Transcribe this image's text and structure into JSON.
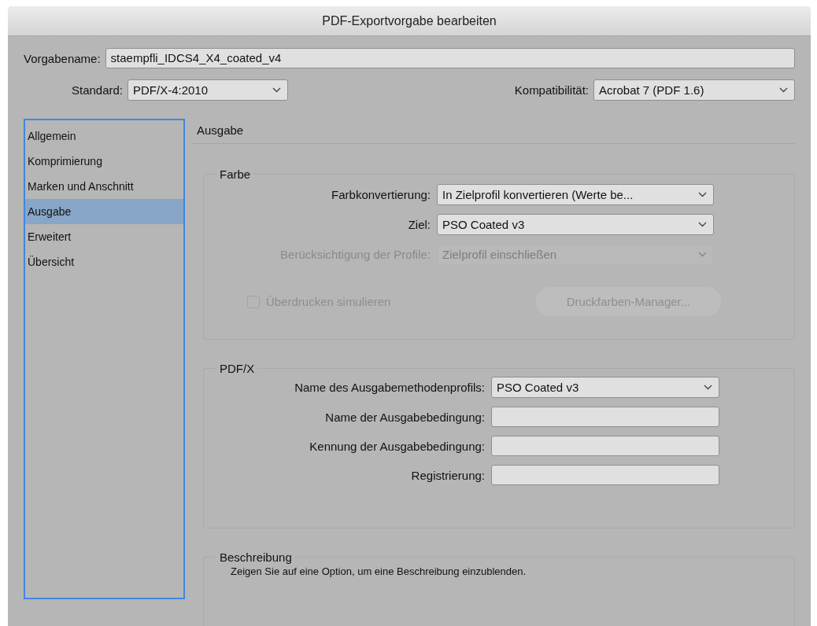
{
  "window": {
    "title": "PDF-Exportvorgabe bearbeiten"
  },
  "preset": {
    "label": "Vorgabename:",
    "value": "staempfli_IDCS4_X4_coated_v4"
  },
  "standard": {
    "label": "Standard:",
    "value": "PDF/X-4:2010"
  },
  "compatibility": {
    "label": "Kompatibilität:",
    "value": "Acrobat 7 (PDF 1.6)"
  },
  "sidebar": {
    "items": [
      {
        "label": "Allgemein",
        "selected": false
      },
      {
        "label": "Komprimierung",
        "selected": false
      },
      {
        "label": "Marken und Anschnitt",
        "selected": false
      },
      {
        "label": "Ausgabe",
        "selected": true
      },
      {
        "label": "Erweitert",
        "selected": false
      },
      {
        "label": "Übersicht",
        "selected": false
      }
    ]
  },
  "panel": {
    "title": "Ausgabe",
    "color_group": {
      "title": "Farbe",
      "rows": [
        {
          "kind": "select",
          "label": "Farbkonvertierung:",
          "value": "In Zielprofil konvertieren (Werte be...",
          "disabled": false
        },
        {
          "kind": "select",
          "label": "Ziel:",
          "value": "PSO Coated v3",
          "disabled": false
        },
        {
          "kind": "select",
          "label": "Berücksichtigung der Profile:",
          "value": "Zielprofil einschließen",
          "disabled": true
        }
      ],
      "checkbox": {
        "label": "Überdrucken simulieren",
        "checked": false,
        "disabled": true
      },
      "button": {
        "label": "Druckfarben-Manager...",
        "disabled": true
      }
    },
    "pdfx_group": {
      "title": "PDF/X",
      "rows": [
        {
          "kind": "select",
          "label": "Name des Ausgabemethodenprofils:",
          "value": "PSO Coated v3",
          "disabled": false
        },
        {
          "kind": "text",
          "label": "Name der Ausgabebedingung:",
          "disabled": false
        },
        {
          "kind": "text",
          "label": "Kennung der Ausgabebedingung:",
          "disabled": false
        },
        {
          "kind": "text",
          "label": "Registrierung:",
          "disabled": false
        }
      ]
    },
    "description_group": {
      "title": "Beschreibung",
      "text": "Zeigen Sie auf eine Option, um eine Beschreibung einzublenden."
    }
  }
}
